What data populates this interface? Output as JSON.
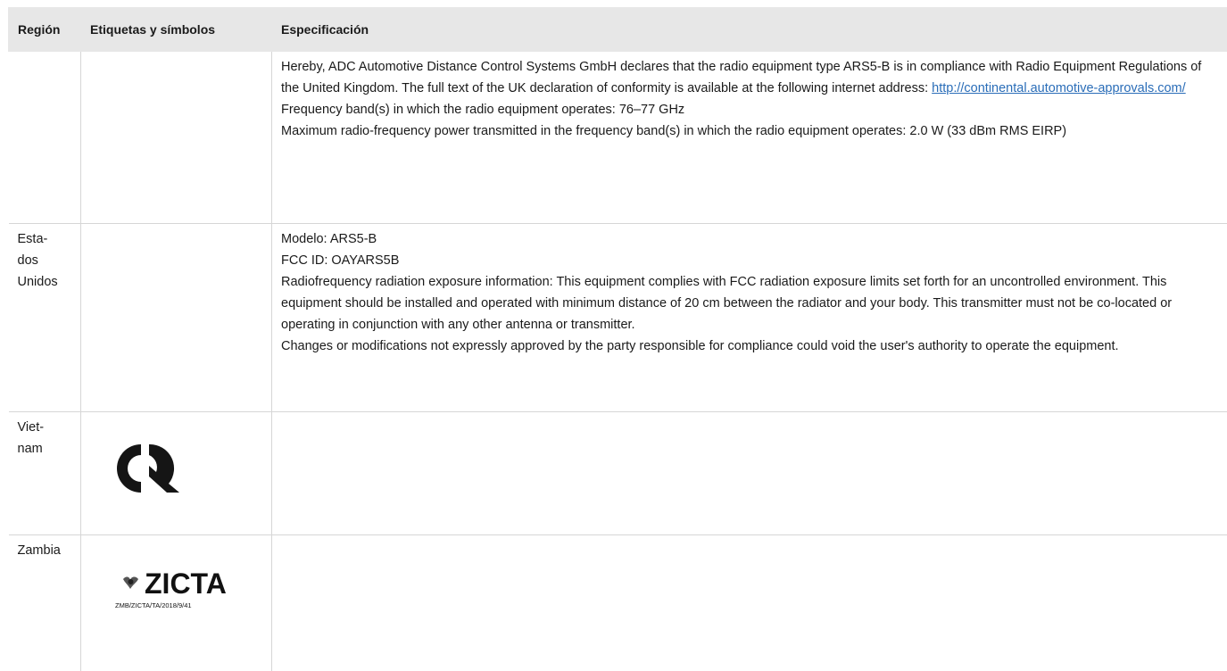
{
  "table": {
    "headers": {
      "region": "Región",
      "labels": "Etiquetas y símbolos",
      "spec": "Especificación"
    },
    "rows": {
      "uk": {
        "region": "",
        "declaration_intro": "Hereby, ADC Automotive Distance Control Systems GmbH declares that the radio equipment type ARS5-B is in compliance with Radio Equipment Regulations of the United Kingdom. The full text of the UK declaration of conformity is available at the following in­ternet address: ",
        "declaration_link": "http://continental.automotive-approvals.com/",
        "frequency": "Frequency band(s) in which the radio equipment operates: 76–77 GHz",
        "power": "Maximum radio-frequency power transmitted in the frequency band(s) in which the radio equipment operates: 2.0 W (33 dBm RMS EIRP)"
      },
      "us": {
        "region": "Esta­dos Unidos",
        "model": "Modelo: ARS5-B",
        "fcc_id": "FCC ID: OAYARS5B",
        "exposure": "Radiofrequency radiation exposure information: This equipment complies with FCC radiation exposure limits set forth for an uncon­trolled environment. This equipment should be installed and operated with minimum distance of 20 cm between the radiator and your body. This transmitter must not be co-located or operating in conjunction with any other antenna or transmitter.",
        "changes": "Changes or modifications not expressly approved by the party responsible for compliance could void the user's authority to operate the equipment."
      },
      "vn": {
        "region": "Viet­nam",
        "logo_icon": "cr-conformity-mark-icon"
      },
      "zm": {
        "region": "Zambia",
        "logo_icon": "zicta-logo-icon",
        "logo_word": "ZICTA",
        "logo_code": "ZMB/ZICTA/TA/2018/9/41"
      }
    }
  }
}
